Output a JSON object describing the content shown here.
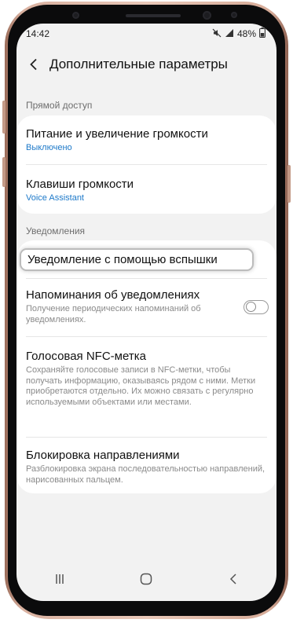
{
  "status_bar": {
    "time": "14:42",
    "battery_percent": "48%",
    "icons": [
      "mute-icon",
      "signal-icon",
      "battery-icon"
    ]
  },
  "header": {
    "title": "Дополнительные параметры",
    "back_icon": "chevron-left-icon"
  },
  "sections": [
    {
      "label": "Прямой доступ",
      "items": [
        {
          "title": "Питание и увеличение громкости",
          "subtitle": "Выключено"
        },
        {
          "title": "Клавиши громкости",
          "subtitle": "Voice Assistant"
        }
      ]
    },
    {
      "label": "Уведомления",
      "items": [
        {
          "title": "Уведомление с помощью вспышки",
          "highlighted": true
        },
        {
          "title": "Напоминания об уведомлениях",
          "subtitle": "Получение периодических напоминаний об уведомлениях.",
          "toggle_on": false
        },
        {
          "title": "Голосовая NFC-метка",
          "subtitle": "Сохраняйте голосовые записи в NFC-метки, чтобы получать информацию, оказываясь рядом с ними. Метки приобретаются отдельно. Их можно связать с регулярно используемыми объектами или местами."
        },
        {
          "title": "Блокировка направлениями",
          "subtitle": "Разблокировка экрана последовательностью направлений, нарисованных пальцем."
        }
      ]
    }
  ],
  "nav_bar": {
    "icons": [
      "recent-apps-icon",
      "home-icon",
      "back-icon"
    ]
  },
  "colors": {
    "accent_blue": "#1d79c9",
    "background": "#f2f2f2",
    "card": "#ffffff",
    "frame": "#d9b1a0"
  }
}
